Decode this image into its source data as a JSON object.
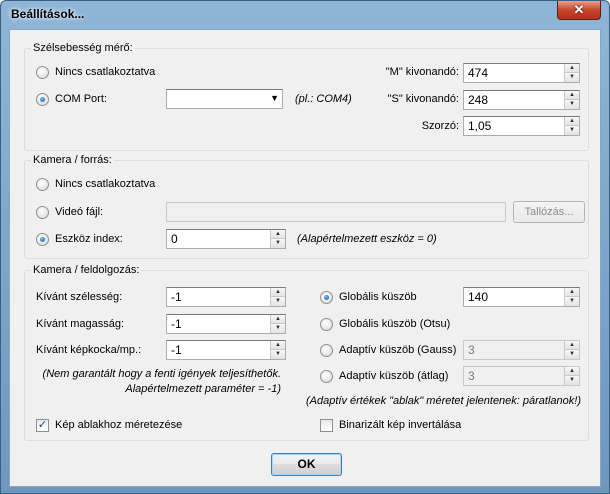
{
  "window": {
    "title": "Beállítások...",
    "close_glyph": "✕"
  },
  "speed_meter": {
    "label": "Szélsebesség mérő:",
    "not_connected": "Nincs csatlakoztatva",
    "com_port": "COM Port:",
    "com_port_value": "",
    "com_port_hint": "(pl.: COM4)",
    "m_label": "\"M\" kivonandó:",
    "m_value": "474",
    "s_label": "\"S\" kivonandó:",
    "s_value": "248",
    "multiplier_label": "Szorzó:",
    "multiplier_value": "1,05",
    "selected": "com_port"
  },
  "camera_source": {
    "label": "Kamera / forrás:",
    "not_connected": "Nincs csatlakoztatva",
    "video_file": "Videó fájl:",
    "video_file_value": "",
    "browse_label": "Tallózás...",
    "device_index": "Eszköz index:",
    "device_index_value": "0",
    "device_hint": "(Alapértelmezett eszköz = 0)",
    "selected": "device_index"
  },
  "camera_processing": {
    "label": "Kamera / feldolgozás:",
    "width_label": "Kívánt szélesség:",
    "width_value": "-1",
    "height_label": "Kívánt magasság:",
    "height_value": "-1",
    "fps_label": "Kívánt képkocka/mp.:",
    "fps_value": "-1",
    "note_line1": "(Nem garantált hogy a fenti igények teljesíthetők.",
    "note_line2": "Alapértelmezett paraméter = -1)",
    "global_threshold": "Globális küszöb",
    "global_threshold_value": "140",
    "otsu_threshold": "Globális küszöb (Otsu)",
    "adaptive_gauss": "Adaptív küszöb (Gauss)",
    "adaptive_gauss_value": "3",
    "adaptive_mean": "Adaptív küszöb (átlag)",
    "adaptive_mean_value": "3",
    "adaptive_note": "(Adaptív értékek \"ablak\" méretet jelentenek: páratlanok!)",
    "resize_to_window": "Kép ablakhoz méretezése",
    "resize_checked": true,
    "invert_binary": "Binarizált kép invertálása",
    "invert_checked": false,
    "selected": "global_threshold"
  },
  "ok_label": "OK",
  "icons": {
    "check": "✓",
    "spin_up": "▲",
    "spin_down": "▼",
    "combo": "▼"
  }
}
